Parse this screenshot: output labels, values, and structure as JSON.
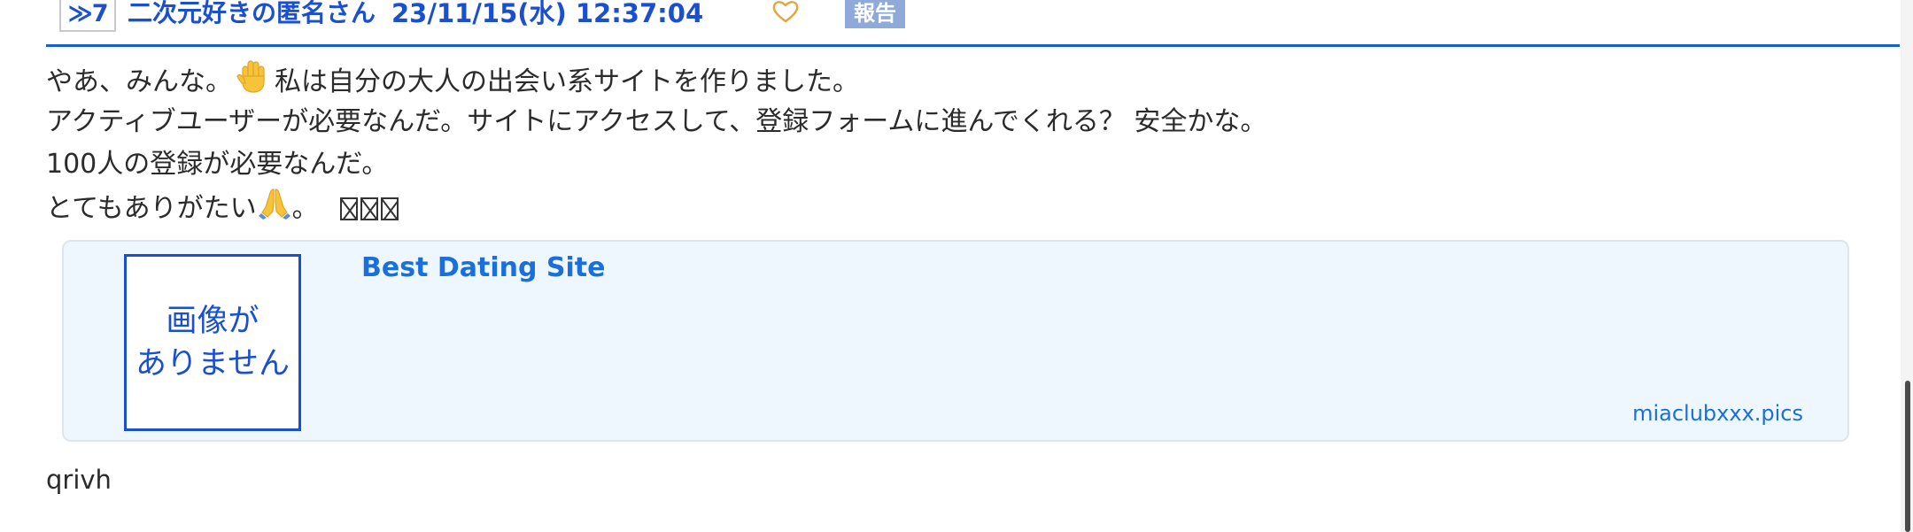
{
  "post": {
    "number": "≫7",
    "author": "二次元好きの匿名さん",
    "date": "23/11/15(水) 12:37:04",
    "report_label": "報告",
    "body": {
      "line1_before": "やあ、みんな。",
      "line1_after": "私は自分の大人の出会い系サイトを作りました。",
      "line2": "アクティブユーザーが必要なんだ。サイトにアクセスして、登録フォームに進んでくれる？ 安全かな。",
      "line3": "100人の登録が必要なんだ。",
      "line4_before": "とてもありがたい",
      "line4_after": "。"
    },
    "trailing": "qrivh"
  },
  "link_card": {
    "no_image_line1": "画像が",
    "no_image_line2": "ありません",
    "title": "Best Dating Site",
    "domain": "miaclubxxx.pics"
  },
  "icons": {
    "like": "heart-outline-icon",
    "wave": "raised-hand-emoji",
    "pray": "folded-hands-emoji",
    "missing": "missing-glyph-box"
  },
  "colors": {
    "accent": "#1a4fcf",
    "link": "#1a6fdc",
    "heart": "#e8a33d",
    "report_bg": "#8fa9d8",
    "card_bg": "#edf7fd"
  }
}
